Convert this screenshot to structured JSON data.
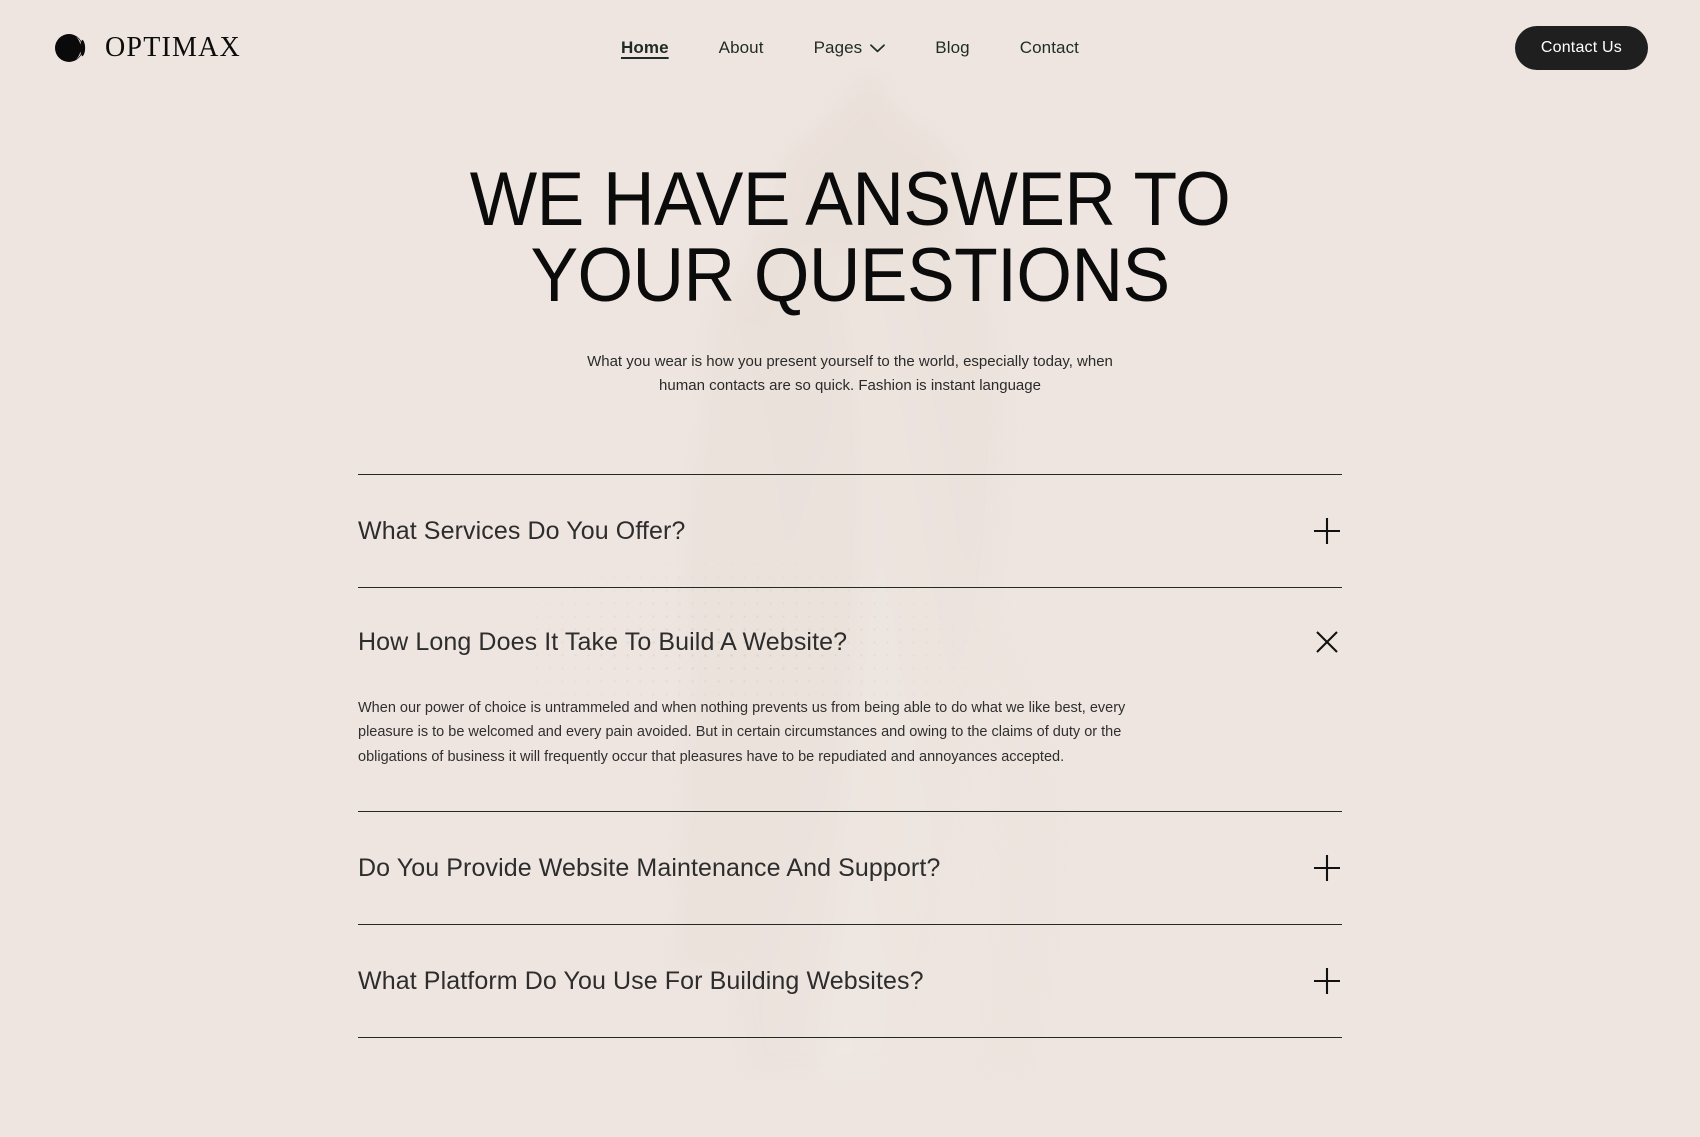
{
  "brand": {
    "name": "OPTIMAX",
    "logo_icon": "eclipse-lens-logo-icon"
  },
  "nav": {
    "items": [
      {
        "label": "Home",
        "active": true,
        "has_dropdown": false
      },
      {
        "label": "About",
        "active": false,
        "has_dropdown": false
      },
      {
        "label": "Pages",
        "active": false,
        "has_dropdown": true
      },
      {
        "label": "Blog",
        "active": false,
        "has_dropdown": false
      },
      {
        "label": "Contact",
        "active": false,
        "has_dropdown": false
      }
    ],
    "dropdown_icon": "chevron-down-icon"
  },
  "header": {
    "cta_label": "Contact Us"
  },
  "hero": {
    "title": "WE HAVE ANSWER TO YOUR QUESTIONS",
    "subtitle": "What you wear is how you present yourself to the world, especially today, when human contacts are so quick. Fashion is instant language"
  },
  "faq": {
    "items": [
      {
        "question": "What Services Do You Offer?",
        "open": false,
        "toggle_icon": "plus-icon",
        "answer": ""
      },
      {
        "question": "How Long Does It Take To Build A Website?",
        "open": true,
        "toggle_icon": "close-icon",
        "answer": "When our power of choice is untrammeled and when nothing prevents us from being able to do what we like best, every pleasure is to be welcomed and every pain avoided. But in certain circumstances and owing to the claims of duty or the obligations of business it will frequently occur that pleasures have to be repudiated and annoyances accepted."
      },
      {
        "question": "Do You Provide Website Maintenance And Support?",
        "open": false,
        "toggle_icon": "plus-icon",
        "answer": ""
      },
      {
        "question": "What Platform Do You Use For Building Websites?",
        "open": false,
        "toggle_icon": "plus-icon",
        "answer": ""
      }
    ]
  },
  "colors": {
    "background": "#EEE5E0",
    "text": "#1C1C1C",
    "divider": "#1F2B24",
    "button_bg": "#1F1F1F",
    "button_text": "#FFFFFF"
  }
}
